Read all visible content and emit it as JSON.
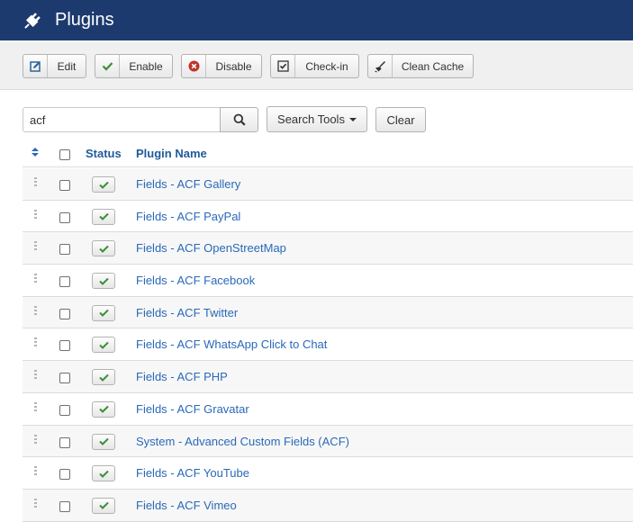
{
  "header": {
    "title": "Plugins",
    "icon": "plug-icon"
  },
  "toolbar": {
    "buttons": [
      {
        "label": "Edit",
        "icon": "edit-icon"
      },
      {
        "label": "Enable",
        "icon": "check-icon"
      },
      {
        "label": "Disable",
        "icon": "disable-icon"
      },
      {
        "label": "Check-in",
        "icon": "checkin-icon"
      },
      {
        "label": "Clean Cache",
        "icon": "clean-cache-icon"
      }
    ]
  },
  "search": {
    "value": "acf",
    "placeholder": "",
    "search_tools_label": "Search Tools",
    "clear_label": "Clear"
  },
  "table": {
    "columns": {
      "status": "Status",
      "name": "Plugin Name"
    },
    "rows": [
      {
        "name": "Fields - ACF Gallery",
        "enabled": true
      },
      {
        "name": "Fields - ACF PayPal",
        "enabled": true
      },
      {
        "name": "Fields - ACF OpenStreetMap",
        "enabled": true
      },
      {
        "name": "Fields - ACF Facebook",
        "enabled": true
      },
      {
        "name": "Fields - ACF Twitter",
        "enabled": true
      },
      {
        "name": "Fields - ACF WhatsApp Click to Chat",
        "enabled": true
      },
      {
        "name": "Fields - ACF PHP",
        "enabled": true
      },
      {
        "name": "Fields - ACF Gravatar",
        "enabled": true
      },
      {
        "name": "System - Advanced Custom Fields (ACF)",
        "enabled": true
      },
      {
        "name": "Fields - ACF YouTube",
        "enabled": true
      },
      {
        "name": "Fields - ACF Vimeo",
        "enabled": true
      }
    ]
  },
  "colors": {
    "header_bg": "#1d3a6e",
    "link": "#2a69b8",
    "column_header": "#1f5b9a",
    "check_green": "#3a8f3a",
    "disable_red": "#c0322b"
  }
}
